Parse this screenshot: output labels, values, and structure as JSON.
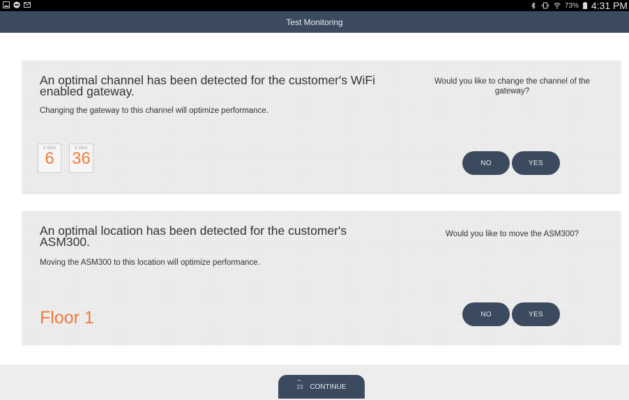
{
  "status_bar": {
    "battery": "73%",
    "time": "4:31 PM",
    "icons_left": [
      "image-icon",
      "minus-circle-icon",
      "mail-icon"
    ],
    "icons_right": [
      "bluetooth-icon",
      "vibrate-icon",
      "wifi-icon",
      "battery-icon"
    ]
  },
  "app_bar": {
    "title": "Test Monitoring"
  },
  "channel_card": {
    "title": "An optimal channel has been detected for the customer's WiFi enabled gateway.",
    "subtitle": "Changing the gateway to this channel will optimize performance.",
    "question": "Would you like to change the channel of the gateway?",
    "channels": [
      {
        "band": "2 GHz",
        "value": "6"
      },
      {
        "band": "5 GHz",
        "value": "36"
      }
    ],
    "no_label": "NO",
    "yes_label": "YES"
  },
  "location_card": {
    "title": "An optimal location has been detected for the customer's ASM300.",
    "subtitle": "Moving the ASM300 to this location will optimize performance.",
    "question": "Would you like to move the ASM300?",
    "location": "Floor 1",
    "no_label": "NO",
    "yes_label": "YES"
  },
  "footer": {
    "countdown": "23",
    "continue_label": "CONTINUE"
  },
  "colors": {
    "accent_orange": "#f07a3a",
    "primary_navy": "#3b4a5e",
    "card_bg": "#f1f1f1"
  }
}
